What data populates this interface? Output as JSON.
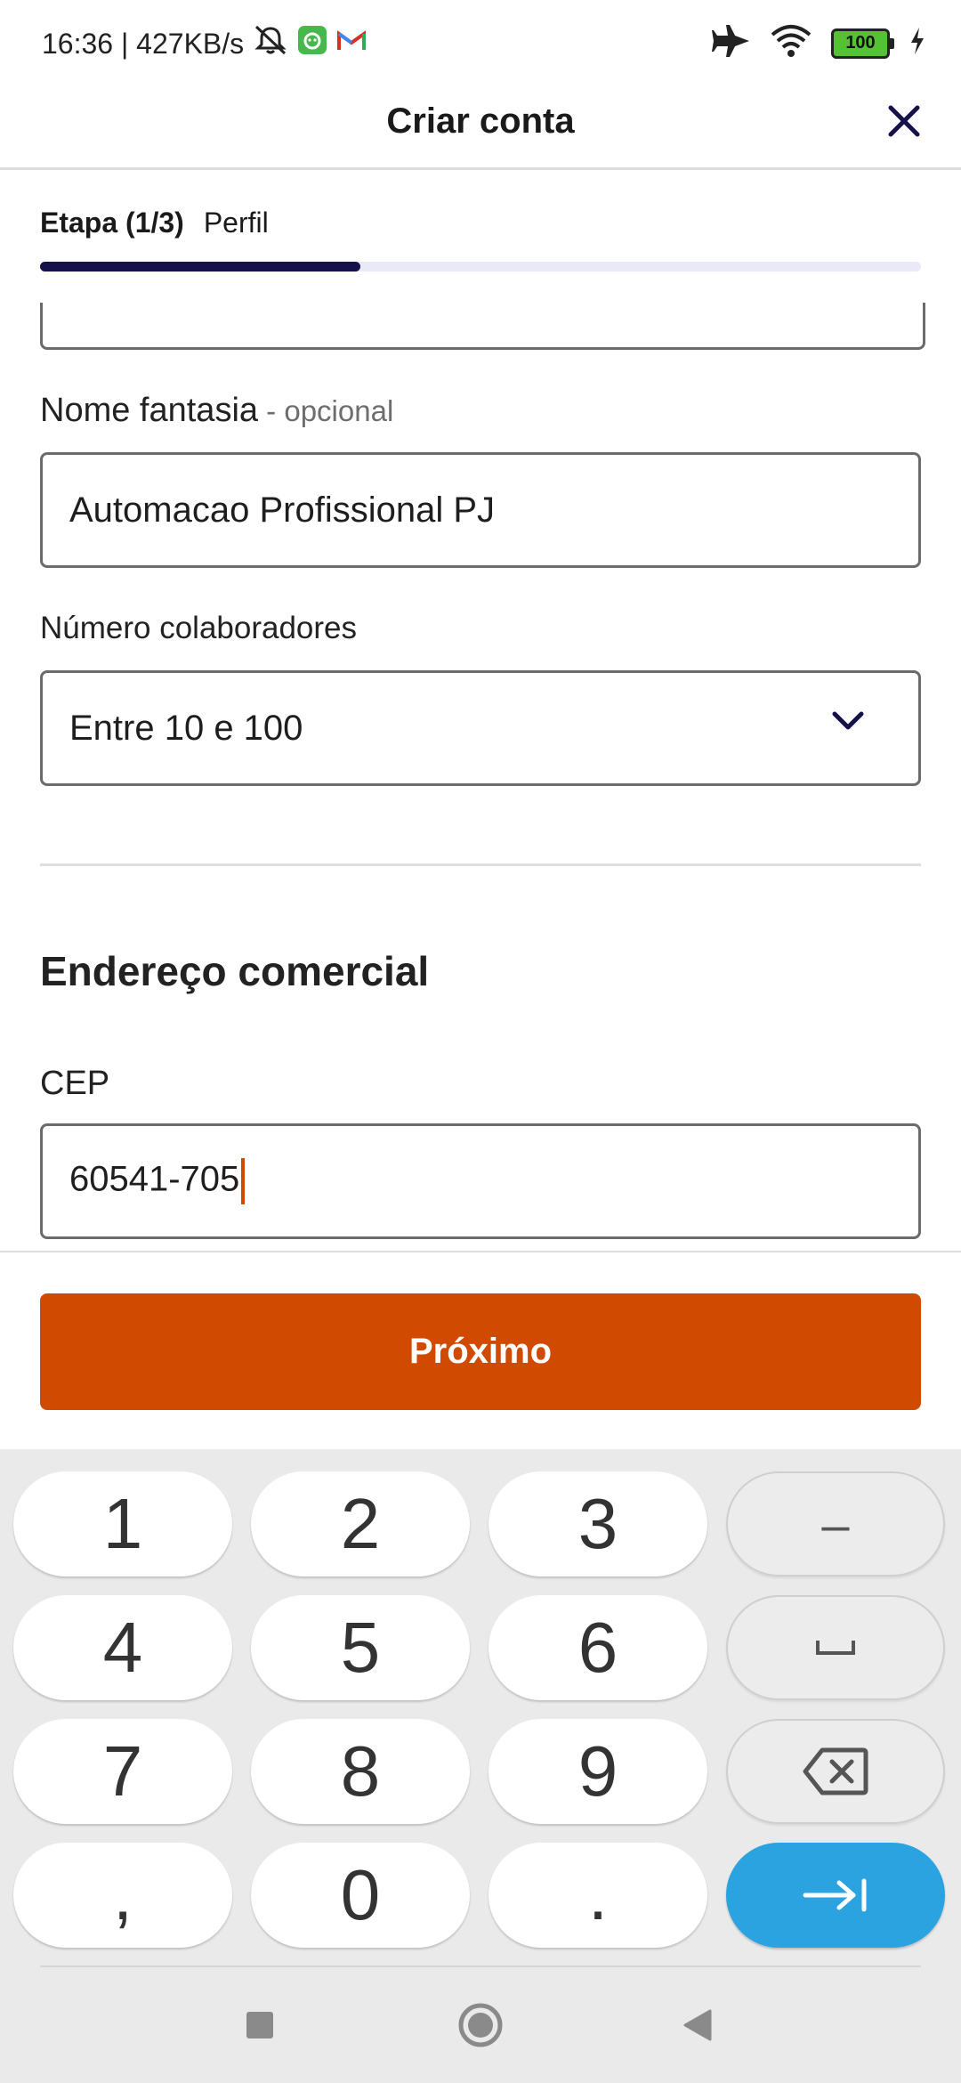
{
  "status_bar": {
    "time_speed": "16:36 | 427KB/s",
    "battery": "100",
    "icons": [
      "mute-icon",
      "app-notification-icon",
      "gmail-icon",
      "airplane-mode-icon",
      "wifi-icon",
      "battery-icon",
      "charging-icon"
    ]
  },
  "app_bar": {
    "title": "Criar conta",
    "close_icon": "close-icon"
  },
  "step": {
    "count": "Etapa (1/3)",
    "name": "Perfil",
    "progress": 0.364
  },
  "form": {
    "trade_name": {
      "label": "Nome fantasia",
      "optional": " - opcional",
      "value": "Automacao Profissional PJ"
    },
    "employees": {
      "label": "Número colaboradores",
      "value": "Entre 10 e 100"
    },
    "section_title": "Endereço comercial",
    "cep": {
      "label": "CEP",
      "value": "60541-705"
    }
  },
  "next_button": "Próximo",
  "keyboard": {
    "rows": [
      [
        "1",
        "2",
        "3",
        "–"
      ],
      [
        "4",
        "5",
        "6",
        "␣"
      ],
      [
        "7",
        "8",
        "9",
        "⌫"
      ],
      [
        ",",
        "0",
        ".",
        "→|"
      ]
    ]
  },
  "colors": {
    "accent": "#d04a02",
    "progress": "#15124a",
    "enter_key": "#2aa3e0"
  }
}
